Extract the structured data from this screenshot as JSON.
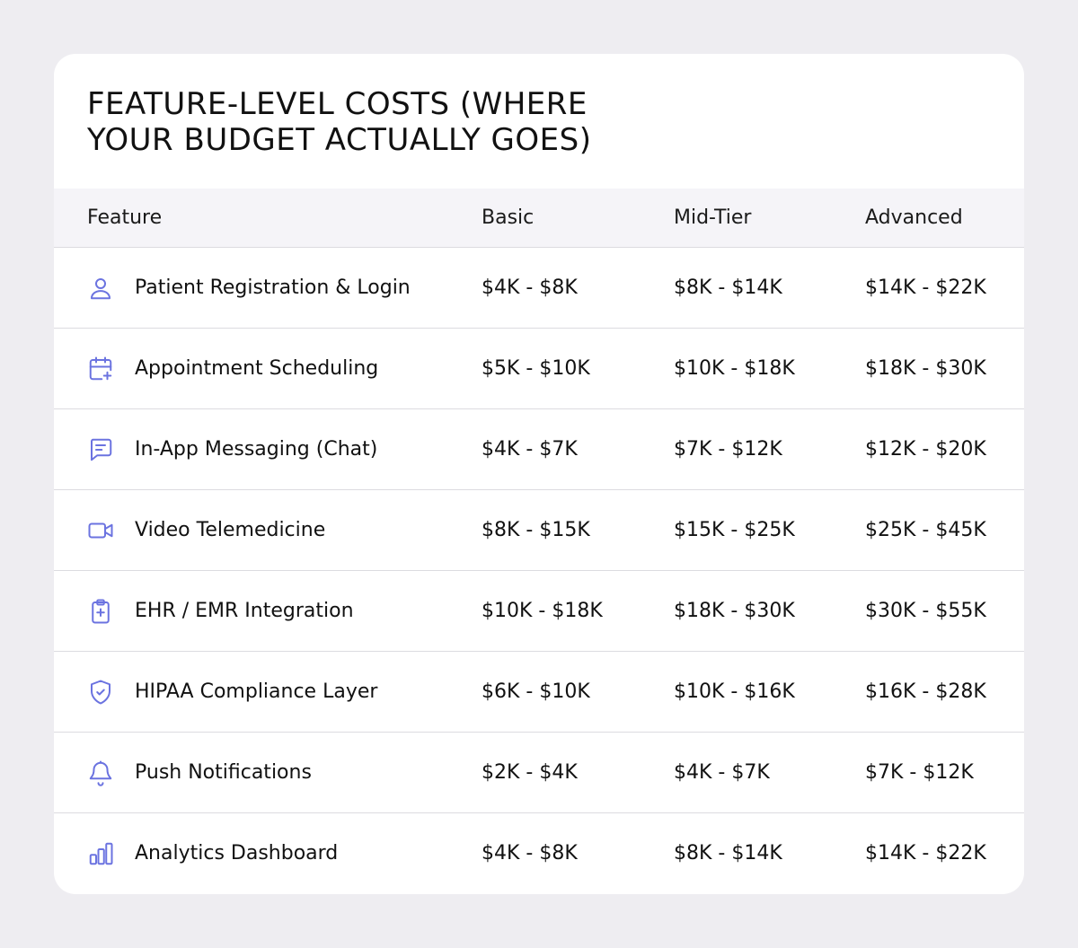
{
  "title": "Feature-Level Costs (Where Your Budget Actually Goes)",
  "accent_color": "#6b73e0",
  "columns": {
    "feature": "Feature",
    "basic": "Basic",
    "mid": "Mid-Tier",
    "advanced": "Advanced"
  },
  "rows": [
    {
      "icon": "user-icon",
      "feature": "Patient Registration & Login",
      "basic": "$4K - $8K",
      "mid": "$8K - $14K",
      "advanced": "$14K - $22K"
    },
    {
      "icon": "calendar-plus-icon",
      "feature": "Appointment Scheduling",
      "basic": "$5K - $10K",
      "mid": "$10K - $18K",
      "advanced": "$18K - $30K"
    },
    {
      "icon": "chat-icon",
      "feature": "In-App Messaging (Chat)",
      "basic": "$4K - $7K",
      "mid": "$7K - $12K",
      "advanced": "$12K - $20K"
    },
    {
      "icon": "video-camera-icon",
      "feature": "Video Telemedicine",
      "basic": "$8K - $15K",
      "mid": "$15K - $25K",
      "advanced": "$25K - $45K"
    },
    {
      "icon": "clipboard-plus-icon",
      "feature": "EHR / EMR Integration",
      "basic": "$10K - $18K",
      "mid": "$18K - $30K",
      "advanced": "$30K - $55K"
    },
    {
      "icon": "shield-check-icon",
      "feature": "HIPAA Compliance Layer",
      "basic": "$6K - $10K",
      "mid": "$10K - $16K",
      "advanced": "$16K - $28K"
    },
    {
      "icon": "bell-icon",
      "feature": "Push Notifications",
      "basic": "$2K - $4K",
      "mid": "$4K - $7K",
      "advanced": "$7K - $12K"
    },
    {
      "icon": "bar-chart-icon",
      "feature": "Analytics Dashboard",
      "basic": "$4K - $8K",
      "mid": "$8K - $14K",
      "advanced": "$14K - $22K"
    }
  ]
}
